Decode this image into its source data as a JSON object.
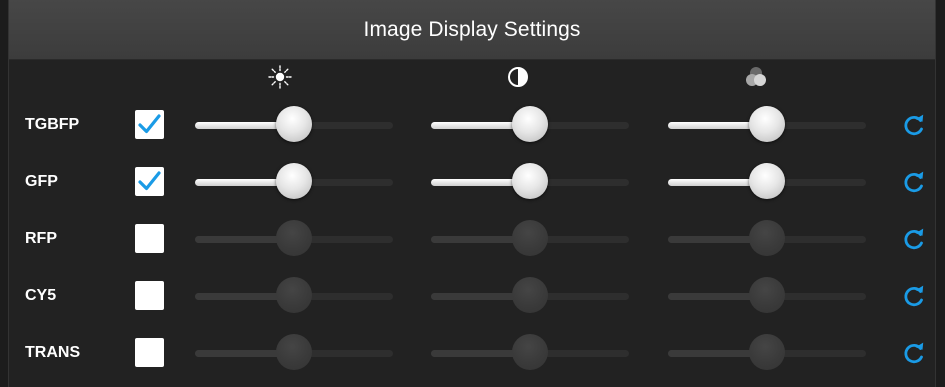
{
  "header": {
    "title": "Image Display Settings"
  },
  "columns": [
    {
      "icon": "brightness-icon"
    },
    {
      "icon": "contrast-icon"
    },
    {
      "icon": "color-channels-icon"
    }
  ],
  "colors": {
    "accent": "#1a9be6",
    "checkbox_bg": "#ffffff",
    "panel_bg": "#222222",
    "header_bg": "#434343",
    "label_text": "#ffffff"
  },
  "channels": [
    {
      "label": "TGBFP",
      "enabled": true,
      "levels": [
        0.5,
        0.5,
        0.5
      ]
    },
    {
      "label": "GFP",
      "enabled": true,
      "levels": [
        0.5,
        0.5,
        0.5
      ]
    },
    {
      "label": "RFP",
      "enabled": false,
      "levels": [
        0.5,
        0.5,
        0.5
      ]
    },
    {
      "label": "CY5",
      "enabled": false,
      "levels": [
        0.5,
        0.5,
        0.5
      ]
    },
    {
      "label": "TRANS",
      "enabled": false,
      "levels": [
        0.5,
        0.5,
        0.5
      ]
    }
  ]
}
